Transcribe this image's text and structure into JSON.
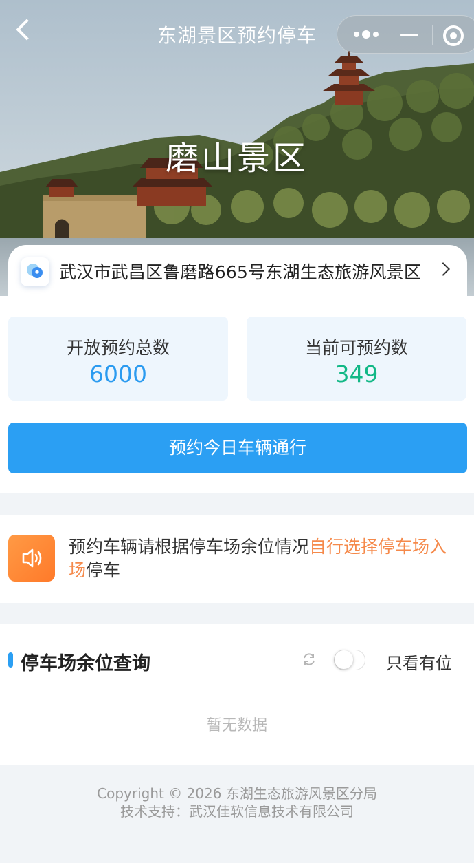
{
  "navbar": {
    "title": "东湖景区预约停车",
    "back_icon": "chevron-left-icon",
    "menu_icons": [
      "more-dots-icon",
      "minimize-icon",
      "close-circle-icon"
    ]
  },
  "hero": {
    "scenic_name": "磨山景区"
  },
  "address": {
    "icon": "location-pin-icon",
    "text": "武汉市武昌区鲁磨路665号东湖生态旅游风景区"
  },
  "stats": {
    "total_label": "开放预约总数",
    "total_value": "6000",
    "available_label": "当前可预约数",
    "available_value": "349",
    "colors": {
      "total": "#2b9bf0",
      "available": "#12b886"
    }
  },
  "reserve_button": {
    "label": "预约今日车辆通行",
    "color": "#2b9ff3"
  },
  "notice": {
    "icon": "speaker-icon",
    "text_before": "预约车辆请根据停车场余位情况",
    "text_highlight": "自行选择停车场入场",
    "text_after": "停车",
    "highlight_color": "#f5894a"
  },
  "parking_query": {
    "title": "停车场余位查询",
    "refresh_icon": "refresh-icon",
    "toggle_on": false,
    "toggle_label": "只看有位",
    "empty_text": "暂无数据"
  },
  "footer": {
    "copyright": "Copyright © 2026 东湖生态旅游风景区分局",
    "support": "技术支持：武汉佳软信息技术有限公司"
  }
}
